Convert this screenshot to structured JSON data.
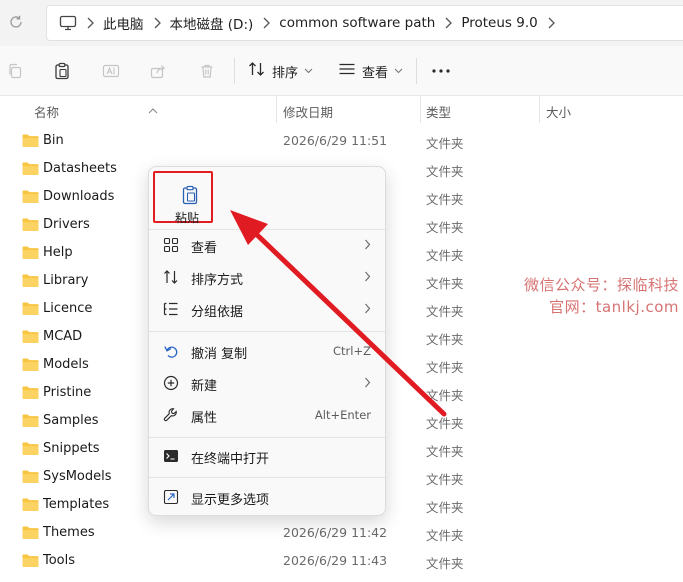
{
  "address": {
    "crumbs": [
      "此电脑",
      "本地磁盘 (D:)",
      "common software path",
      "Proteus 9.0"
    ]
  },
  "toolbar": {
    "sort_label": "排序",
    "view_label": "查看"
  },
  "columns": {
    "name": "名称",
    "date": "修改日期",
    "type": "类型",
    "size": "大小"
  },
  "files": [
    {
      "name": "Bin",
      "date": "2026/6/29 11:51",
      "type": "文件夹"
    },
    {
      "name": "Datasheets",
      "date": "",
      "type": "文件夹"
    },
    {
      "name": "Downloads",
      "date": "",
      "type": "文件夹"
    },
    {
      "name": "Drivers",
      "date": "",
      "type": "文件夹"
    },
    {
      "name": "Help",
      "date": "",
      "type": "文件夹"
    },
    {
      "name": "Library",
      "date": "",
      "type": "文件夹"
    },
    {
      "name": "Licence",
      "date": "",
      "type": "文件夹"
    },
    {
      "name": "MCAD",
      "date": "",
      "type": "文件夹"
    },
    {
      "name": "Models",
      "date": "",
      "type": "文件夹"
    },
    {
      "name": "Pristine",
      "date": "",
      "type": "文件夹"
    },
    {
      "name": "Samples",
      "date": "",
      "type": "文件夹"
    },
    {
      "name": "Snippets",
      "date": "",
      "type": "文件夹"
    },
    {
      "name": "SysModels",
      "date": "",
      "type": "文件夹"
    },
    {
      "name": "Templates",
      "date": "",
      "type": "文件夹"
    },
    {
      "name": "Themes",
      "date": "2026/6/29 11:42",
      "type": "文件夹"
    },
    {
      "name": "Tools",
      "date": "2026/6/29 11:43",
      "type": "文件夹"
    }
  ],
  "context_menu": {
    "paste_label": "粘贴",
    "items": [
      {
        "label": "查看",
        "shortcut": ""
      },
      {
        "label": "排序方式",
        "shortcut": ""
      },
      {
        "label": "分组依据",
        "shortcut": ""
      },
      {
        "label": "撤消 复制",
        "shortcut": "Ctrl+Z"
      },
      {
        "label": "新建",
        "shortcut": ""
      },
      {
        "label": "属性",
        "shortcut": "Alt+Enter"
      },
      {
        "label": "在终端中打开",
        "shortcut": ""
      },
      {
        "label": "显示更多选项",
        "shortcut": ""
      }
    ]
  },
  "watermark": {
    "line1": "微信公众号：探临科技",
    "line2": "官网：tanlkj.com"
  },
  "colors": {
    "folder": "#f8c542",
    "highlight": "#e11b22",
    "arrow": "#e11b22"
  }
}
